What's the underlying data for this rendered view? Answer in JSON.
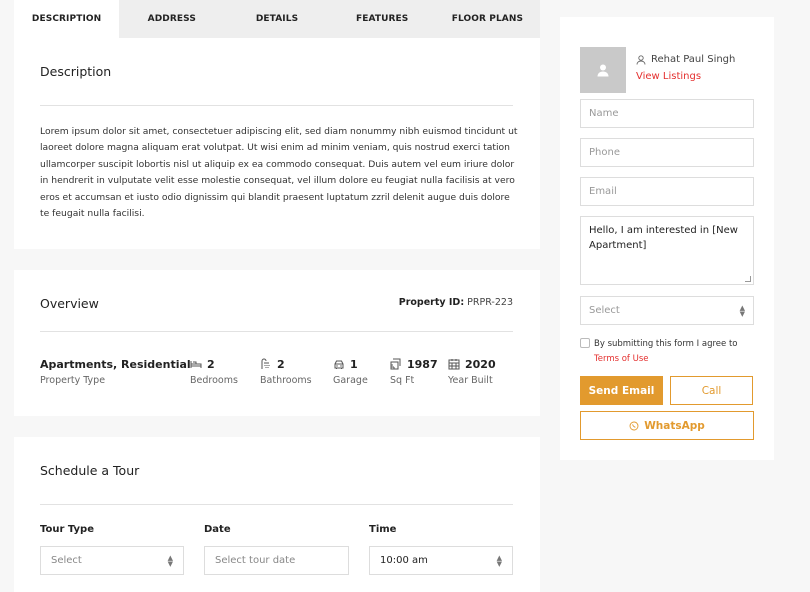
{
  "tabs": [
    {
      "label": "DESCRIPTION",
      "active": true
    },
    {
      "label": "ADDRESS"
    },
    {
      "label": "DETAILS"
    },
    {
      "label": "FEATURES"
    },
    {
      "label": "FLOOR PLANS"
    }
  ],
  "description": {
    "title": "Description",
    "text": "Lorem ipsum dolor sit amet, consectetuer adipiscing elit, sed diam nonummy nibh euismod tincidunt ut laoreet dolore magna aliquam erat volutpat. Ut wisi enim ad minim veniam, quis nostrud exerci tation ullamcorper suscipit lobortis nisl ut aliquip ex ea commodo consequat. Duis autem vel eum iriure dolor in hendrerit in vulputate velit esse molestie consequat, vel illum dolore eu feugiat nulla facilisis at vero eros et accumsan et iusto odio dignissim qui blandit praesent luptatum zzril delenit augue duis dolore te feugait nulla facilisi."
  },
  "overview": {
    "title": "Overview",
    "property_id_label": "Property ID:",
    "property_id": "PRPR-223",
    "type_value": "Apartments, Residential",
    "type_label": "Property Type",
    "bedrooms_value": "2",
    "bedrooms_label": "Bedrooms",
    "bathrooms_value": "2",
    "bathrooms_label": "Bathrooms",
    "garage_value": "1",
    "garage_label": "Garage",
    "size_value": "1987",
    "size_label": "Sq Ft",
    "year_value": "2020",
    "year_label": "Year Built"
  },
  "tour": {
    "title": "Schedule a Tour",
    "type_label": "Tour Type",
    "type_value": "Select",
    "date_label": "Date",
    "date_placeholder": "Select tour date",
    "time_label": "Time",
    "time_value": "10:00 am"
  },
  "agent": {
    "name": "Rehat Paul Singh",
    "view_listings": "View Listings"
  },
  "contact_form": {
    "name_placeholder": "Name",
    "phone_placeholder": "Phone",
    "email_placeholder": "Email",
    "message": "Hello, I am interested in [New Apartment]",
    "select_value": "Select",
    "terms_text": "By submitting this form I agree to",
    "terms_link": "Terms of Use",
    "send_label": "Send Email",
    "call_label": "Call",
    "whatsapp_label": "WhatsApp"
  },
  "colors": {
    "accent": "#e29a2e",
    "link": "#e4302f"
  }
}
